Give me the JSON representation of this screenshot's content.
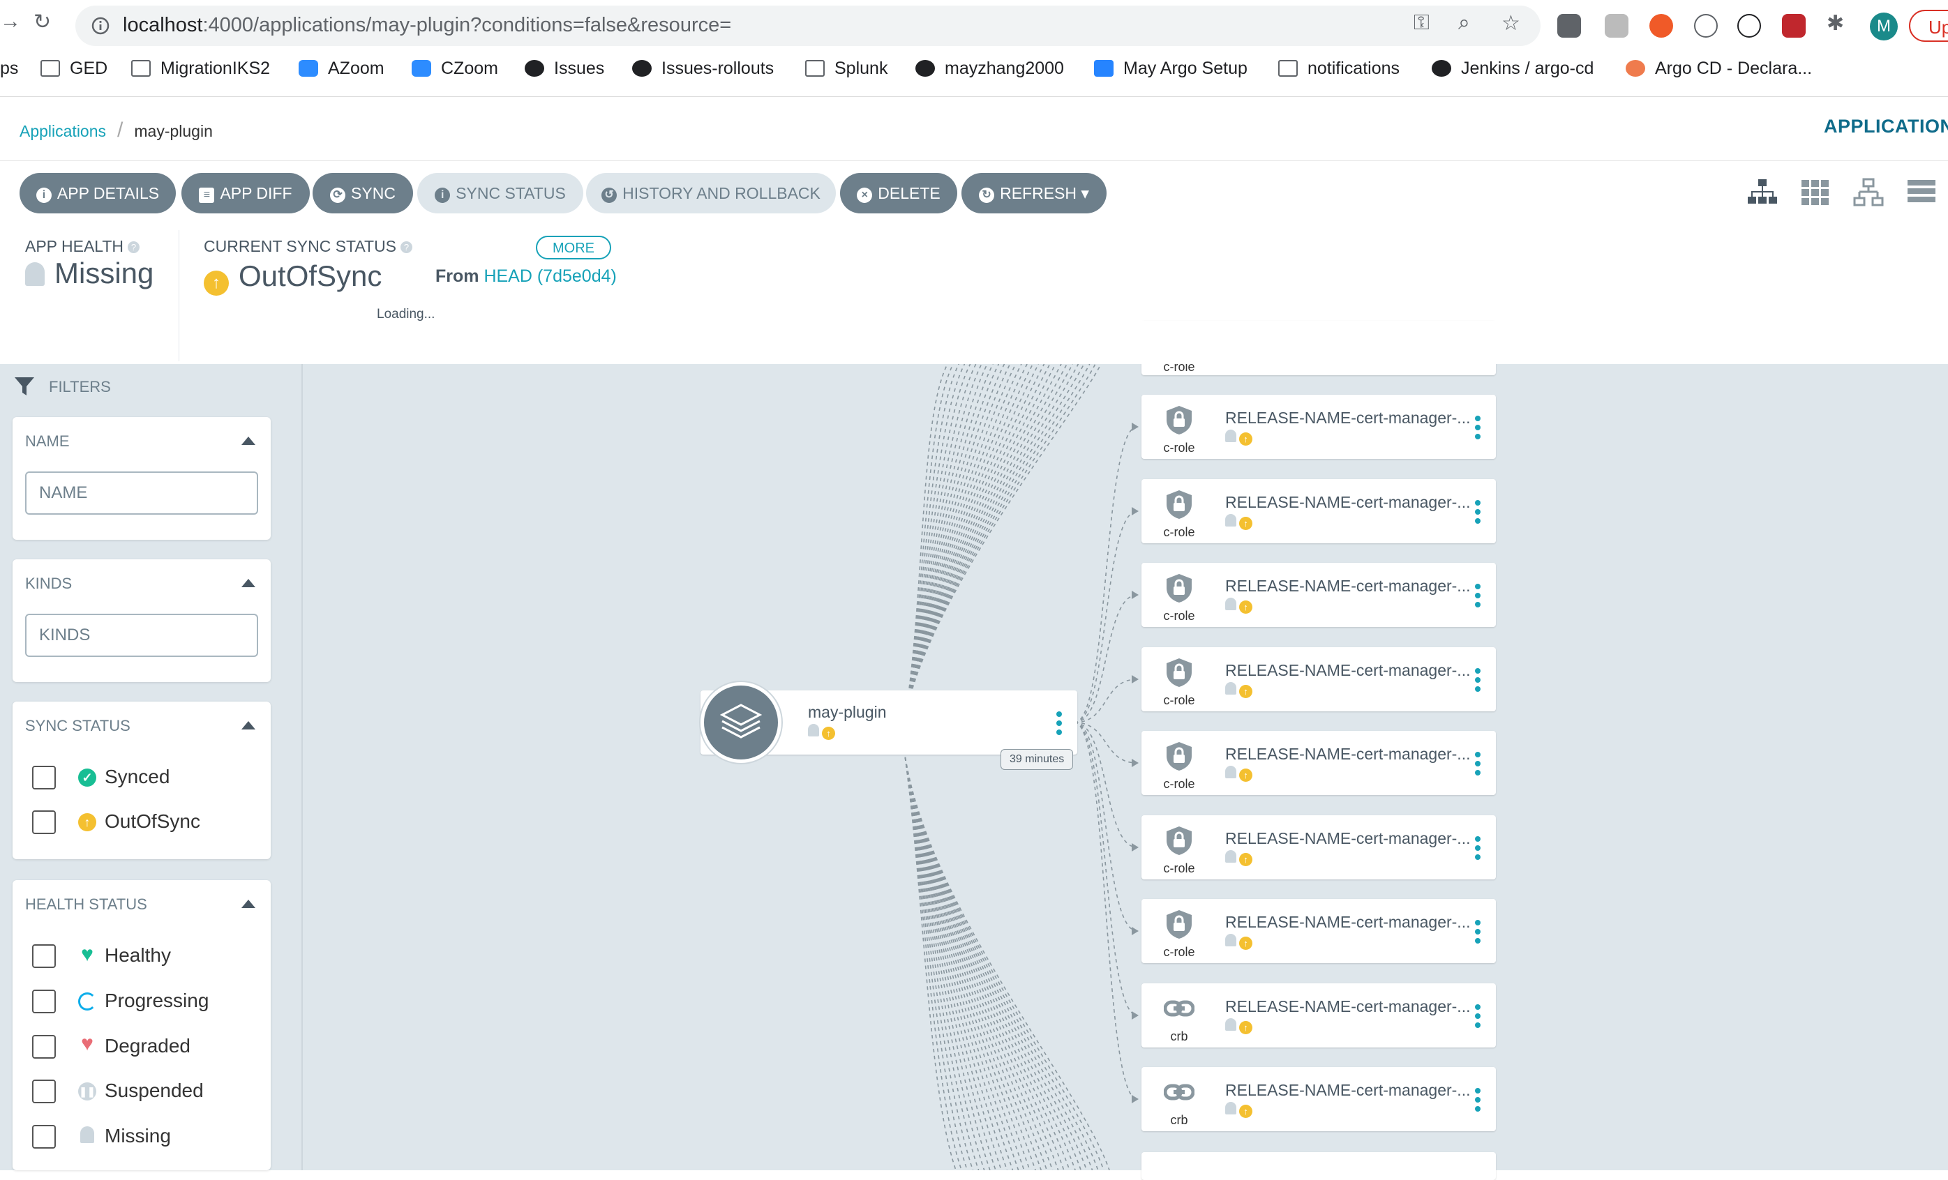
{
  "browser": {
    "url_host": "localhost",
    "url_rest": ":4000/applications/may-plugin?conditions=false&resource=",
    "update_label": "Up",
    "avatar_letter": "M",
    "bookmarks": [
      "ps",
      "GED",
      "MigrationIKS2",
      "AZoom",
      "CZoom",
      "Issues",
      "Issues-rollouts",
      "Splunk",
      "mayzhang2000",
      "May Argo Setup",
      "notifications",
      "Jenkins / argo-cd",
      "Argo CD - Declara..."
    ]
  },
  "header": {
    "breadcrumb_root": "Applications",
    "breadcrumb_current": "may-plugin",
    "applications_title": "APPLICATION"
  },
  "toolbar": {
    "app_details": "APP DETAILS",
    "app_diff": "APP DIFF",
    "sync": "SYNC",
    "sync_status": "SYNC STATUS",
    "history": "HISTORY AND ROLLBACK",
    "delete": "DELETE",
    "refresh": "REFRESH"
  },
  "status": {
    "health_label": "APP HEALTH",
    "health_value": "Missing",
    "sync_label": "CURRENT SYNC STATUS",
    "sync_value": "OutOfSync",
    "more": "MORE",
    "from_prefix": "From",
    "revision": "HEAD (7d5e0d4)",
    "loading": "Loading..."
  },
  "filters": {
    "title": "FILTERS",
    "name_title": "NAME",
    "name_placeholder": "NAME",
    "kinds_title": "KINDS",
    "kinds_placeholder": "KINDS",
    "sync_title": "SYNC STATUS",
    "sync_options": [
      "Synced",
      "OutOfSync"
    ],
    "health_title": "HEALTH STATUS",
    "health_options": [
      "Healthy",
      "Progressing",
      "Degraded",
      "Suspended",
      "Missing"
    ]
  },
  "graph": {
    "root_name": "may-plugin",
    "root_age": "39 minutes",
    "partial_top_kind": "c-role",
    "node_name": "RELEASE-NAME-cert-manager-...",
    "nodes": [
      {
        "kind": "c-role"
      },
      {
        "kind": "c-role"
      },
      {
        "kind": "c-role"
      },
      {
        "kind": "c-role"
      },
      {
        "kind": "c-role"
      },
      {
        "kind": "c-role"
      },
      {
        "kind": "c-role"
      },
      {
        "kind": "crb"
      },
      {
        "kind": "crb"
      }
    ]
  },
  "colors": {
    "accent": "#17a2b8",
    "button": "#6d7f8b",
    "out_of_sync": "#f4c030",
    "synced": "#18be94",
    "degraded": "#e96d76"
  }
}
